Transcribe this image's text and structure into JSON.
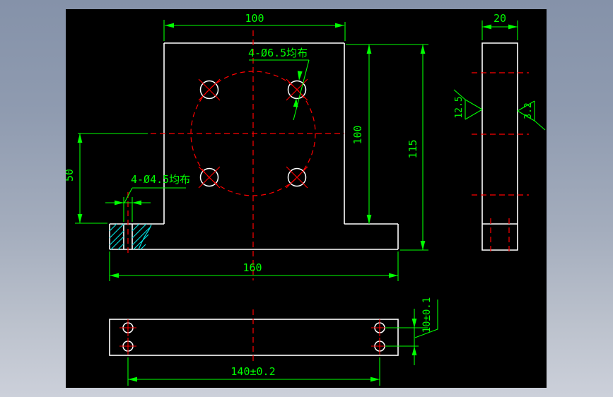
{
  "window": {
    "canvas_color": "#000000",
    "frame_gradient_top": "#8592a9",
    "frame_gradient_bottom": "#ccd0da"
  },
  "colors": {
    "outline": "#ffffff",
    "dimension": "#00ff00",
    "centerline": "#ff0000",
    "hatch": "#00dede"
  },
  "drawing": {
    "front_view": {
      "dim_top_width": "100",
      "note_bolt_holes": "4-Ø6.5均布",
      "note_base_holes": "4-Ø4.5均布",
      "dim_center_height": "50",
      "dim_body_height": "100",
      "dim_total_height": "115",
      "dim_base_width": "160"
    },
    "side_view": {
      "dim_width": "20",
      "roughness_left": "12.5",
      "roughness_right": "3.2"
    },
    "bottom_view": {
      "dim_hole_spacing_x": "140±0.2",
      "dim_hole_spacing_y": "10±0.1"
    }
  }
}
